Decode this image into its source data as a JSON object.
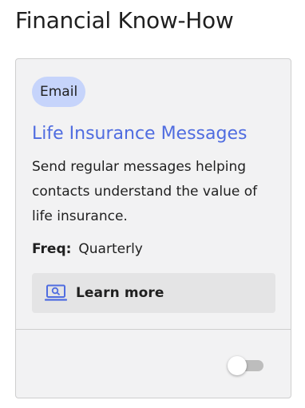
{
  "section": {
    "title": "Financial Know-How"
  },
  "card": {
    "badge": "Email",
    "title": "Life Insurance Messages",
    "description": "Send regular messages helping contacts understand the value of life insurance.",
    "freq_label": "Freq:",
    "freq_value": "Quarterly",
    "learn_more_label": "Learn more",
    "learn_more_icon": "laptop-search-icon",
    "toggle_enabled": false
  },
  "colors": {
    "accent": "#4f6ce0",
    "badge_bg": "#c6d4fb",
    "card_bg": "#f2f2f3",
    "button_bg": "#e4e4e5"
  }
}
